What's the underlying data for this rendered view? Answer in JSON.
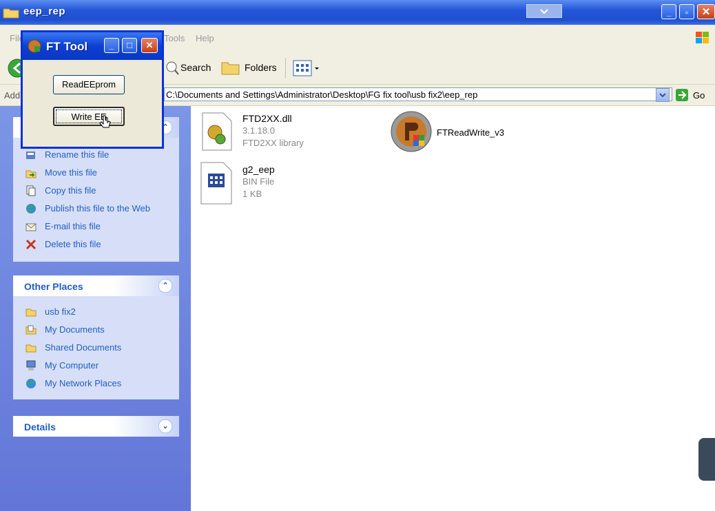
{
  "window": {
    "title": "eep_rep"
  },
  "menu": {
    "file": "File",
    "tools": "Tools",
    "help": "Help"
  },
  "toolbar": {
    "search": "Search",
    "folders": "Folders"
  },
  "address": {
    "label": "Address",
    "path": "C:\\Documents and Settings\\Administrator\\Desktop\\FG fix tool\\usb fix2\\eep_rep",
    "go": "Go"
  },
  "file_tasks": {
    "items": [
      {
        "label": "Rename this file",
        "icon": "rename-icon"
      },
      {
        "label": "Move this file",
        "icon": "move-icon"
      },
      {
        "label": "Copy this file",
        "icon": "copy-icon"
      },
      {
        "label": "Publish this file to the Web",
        "icon": "publish-web-icon"
      },
      {
        "label": "E-mail this file",
        "icon": "email-icon"
      },
      {
        "label": "Delete this file",
        "icon": "delete-icon"
      }
    ]
  },
  "other_places": {
    "title": "Other Places",
    "items": [
      {
        "label": "usb fix2",
        "icon": "folder-icon"
      },
      {
        "label": "My Documents",
        "icon": "my-documents-icon"
      },
      {
        "label": "Shared Documents",
        "icon": "folder-icon"
      },
      {
        "label": "My Computer",
        "icon": "my-computer-icon"
      },
      {
        "label": "My Network Places",
        "icon": "network-places-icon"
      }
    ]
  },
  "details": {
    "title": "Details"
  },
  "files": [
    {
      "name": "FTD2XX.dll",
      "line2": "3.1.18.0",
      "line3": "FTD2XX library",
      "icon": "dll-icon"
    },
    {
      "name": "g2_eep",
      "line2": "BIN File",
      "line3": "1 KB",
      "icon": "bin-file-icon"
    },
    {
      "name": "FTReadWrite_v3",
      "icon": "app-icon"
    }
  ],
  "ft_tool": {
    "title": "FT Tool",
    "read_button": "ReadEEprom",
    "write_button": "Write EE"
  },
  "colors": {
    "titlebar": "#245edb",
    "task_pane": "#6f86e0",
    "link": "#215dc6"
  }
}
